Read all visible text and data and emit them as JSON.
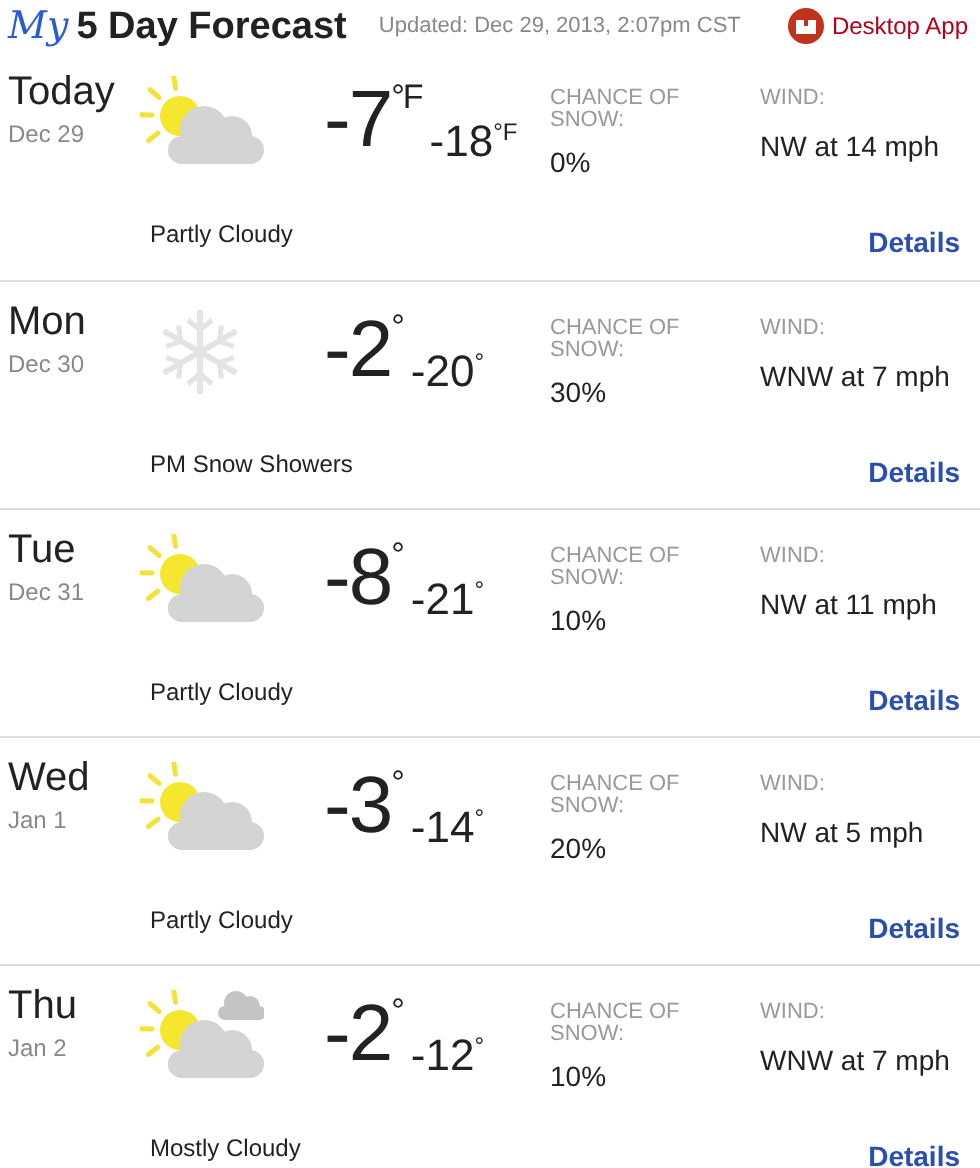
{
  "header": {
    "logo": "My",
    "title": "5 Day Forecast",
    "updated": "Updated: Dec 29, 2013, 2:07pm CST",
    "app_link": "Desktop App"
  },
  "days": [
    {
      "day": "Today",
      "date": "Dec 29",
      "kind": "partly-cloudy",
      "high": "-7",
      "high_unit": "°F",
      "low": "-18",
      "low_unit": "°F",
      "snow_label": "CHANCE OF SNOW:",
      "snow": "0%",
      "wind_label": "WIND:",
      "wind": "NW at 14 mph",
      "condition": "Partly Cloudy",
      "details": "Details"
    },
    {
      "day": "Mon",
      "date": "Dec 30",
      "kind": "snow",
      "high": "-2",
      "high_unit": "°",
      "low": "-20",
      "low_unit": "°",
      "snow_label": "CHANCE OF SNOW:",
      "snow": "30%",
      "wind_label": "WIND:",
      "wind": "WNW at 7 mph",
      "condition": "PM Snow Showers",
      "details": "Details"
    },
    {
      "day": "Tue",
      "date": "Dec 31",
      "kind": "partly-cloudy",
      "high": "-8",
      "high_unit": "°",
      "low": "-21",
      "low_unit": "°",
      "snow_label": "CHANCE OF SNOW:",
      "snow": "10%",
      "wind_label": "WIND:",
      "wind": "NW at 11 mph",
      "condition": "Partly Cloudy",
      "details": "Details"
    },
    {
      "day": "Wed",
      "date": "Jan 1",
      "kind": "partly-cloudy",
      "high": "-3",
      "high_unit": "°",
      "low": "-14",
      "low_unit": "°",
      "snow_label": "CHANCE OF SNOW:",
      "snow": "20%",
      "wind_label": "WIND:",
      "wind": "NW at 5 mph",
      "condition": "Partly Cloudy",
      "details": "Details"
    },
    {
      "day": "Thu",
      "date": "Jan 2",
      "kind": "mostly-cloudy",
      "high": "-2",
      "high_unit": "°",
      "low": "-12",
      "low_unit": "°",
      "snow_label": "CHANCE OF SNOW:",
      "snow": "10%",
      "wind_label": "WIND:",
      "wind": "WNW at 7 mph",
      "condition": "Mostly Cloudy",
      "details": "Details"
    }
  ]
}
